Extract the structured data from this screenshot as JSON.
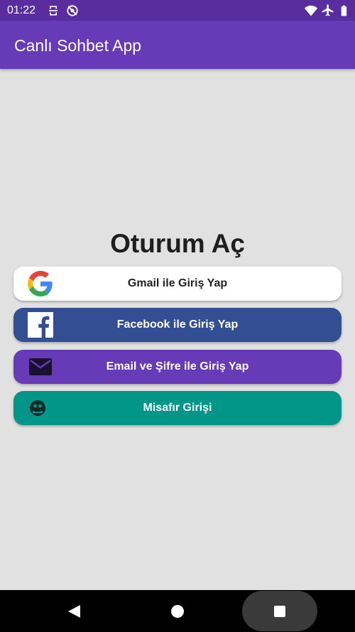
{
  "status_bar": {
    "time": "01:22",
    "icons_left": [
      "sync-icon",
      "location-off-icon"
    ],
    "icons_right": [
      "wifi-icon",
      "airplane-icon",
      "battery-icon"
    ]
  },
  "app_bar": {
    "title": "Canlı Sohbet App",
    "color": "#673ab7"
  },
  "login": {
    "heading": "Oturum Aç",
    "buttons": [
      {
        "label": "Gmail ile Giriş Yap",
        "icon": "google-icon",
        "color": "#ffffff"
      },
      {
        "label": "Facebook ile Giriş Yap",
        "icon": "facebook-icon",
        "color": "#344e93"
      },
      {
        "label": "Email ve Şifre ile Giriş Yap",
        "icon": "mail-icon",
        "color": "#673ab7"
      },
      {
        "label": "Misafır Girişi",
        "icon": "guest-icon",
        "color": "#009688"
      }
    ]
  },
  "nav_bar": {
    "buttons": [
      "back-icon",
      "home-icon",
      "recents-icon"
    ]
  }
}
